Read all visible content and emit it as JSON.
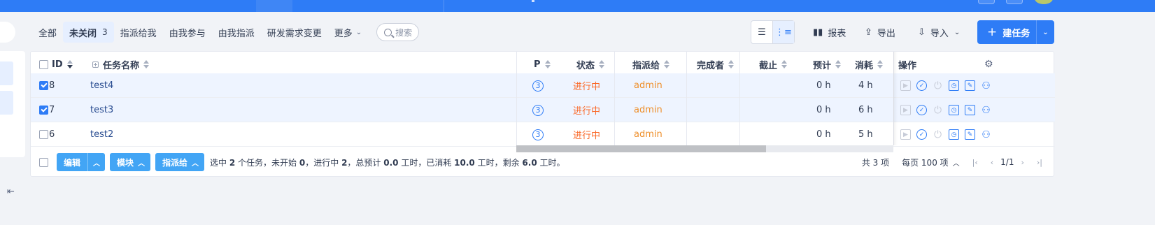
{
  "nav": {
    "items": [
      {
        "label": "全部"
      },
      {
        "label": "未关闭",
        "count": "3",
        "active": true
      },
      {
        "label": "指派给我"
      },
      {
        "label": "由我参与"
      },
      {
        "label": "由我指派"
      },
      {
        "label": "研发需求变更"
      },
      {
        "label": "更多"
      }
    ],
    "search_placeholder": "搜索"
  },
  "toolbar": {
    "report_label": "报表",
    "export_label": "导出",
    "import_label": "导入",
    "create_label": "建任务"
  },
  "table": {
    "headers": {
      "id": "ID",
      "name": "任务名称",
      "pri": "P",
      "status": "状态",
      "assigned": "指派给",
      "finished_by": "完成者",
      "deadline": "截止",
      "estimate": "预计",
      "consumed": "消耗",
      "actions": "操作"
    },
    "rows": [
      {
        "checked": true,
        "id": "8",
        "name": "test4",
        "pri": "3",
        "status": "进行中",
        "assigned": "admin",
        "finished_by": "",
        "deadline": "",
        "estimate": "0 h",
        "consumed": "4 h"
      },
      {
        "checked": true,
        "id": "7",
        "name": "test3",
        "pri": "3",
        "status": "进行中",
        "assigned": "admin",
        "finished_by": "",
        "deadline": "",
        "estimate": "0 h",
        "consumed": "6 h"
      },
      {
        "checked": false,
        "id": "6",
        "name": "test2",
        "pri": "3",
        "status": "进行中",
        "assigned": "admin",
        "finished_by": "",
        "deadline": "",
        "estimate": "0 h",
        "consumed": "5 h"
      }
    ],
    "action_icons": [
      "start-icon",
      "finish-icon",
      "close-icon",
      "record-effort-icon",
      "edit-icon",
      "batch-create-icon"
    ]
  },
  "footer": {
    "edit_label": "编辑",
    "module_label": "模块",
    "assign_label": "指派给",
    "summary": {
      "p1": "选中 ",
      "selected": "2",
      "p2": " 个任务，未开始 ",
      "wait": "0",
      "p3": "，进行中 ",
      "doing": "2",
      "p4": "，总预计 ",
      "estimate": "0.0",
      "p5": " 工时，已消耗 ",
      "consumed": "10.0",
      "p6": " 工时，剩余 ",
      "left": "6.0",
      "p7": " 工时。"
    },
    "total_label": "共 3 项",
    "per_page_label": "每页 100 项",
    "page_label": "1/1"
  },
  "colors": {
    "primary": "#2e7cf6",
    "status_doing": "#fa6a2a",
    "assignee": "#ee8f2a",
    "batch_button": "#42a5f5"
  }
}
